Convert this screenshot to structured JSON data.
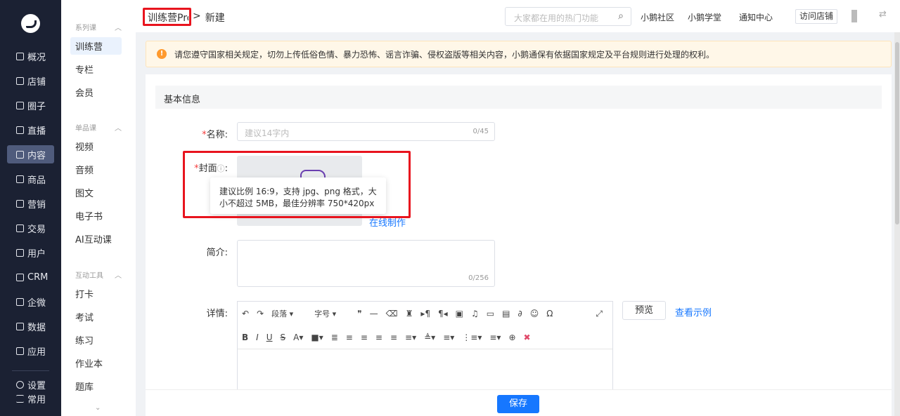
{
  "nav": {
    "items": [
      {
        "label": "概况",
        "icon": "pie-chart-icon"
      },
      {
        "label": "店铺",
        "icon": "store-icon"
      },
      {
        "label": "圈子",
        "icon": "community-icon"
      },
      {
        "label": "直播",
        "icon": "live-icon"
      },
      {
        "label": "内容",
        "icon": "document-icon",
        "active": true
      },
      {
        "label": "商品",
        "icon": "goods-icon"
      },
      {
        "label": "营销",
        "icon": "megaphone-icon"
      },
      {
        "label": "交易",
        "icon": "trade-icon"
      },
      {
        "label": "用户",
        "icon": "user-icon"
      },
      {
        "label": "CRM",
        "icon": "users-icon"
      },
      {
        "label": "企微",
        "icon": "chat-icon"
      },
      {
        "label": "数据",
        "icon": "data-icon"
      },
      {
        "label": "应用",
        "icon": "apps-icon"
      }
    ],
    "settings": "设置",
    "common": "常用"
  },
  "sub": {
    "sections": [
      {
        "title": "系列课",
        "items": [
          "训练营",
          "专栏",
          "会员"
        ]
      },
      {
        "title": "单品课",
        "items": [
          "视频",
          "音频",
          "图文",
          "电子书",
          "AI互动课"
        ]
      },
      {
        "title": "互动工具",
        "items": [
          "打卡",
          "考试",
          "练习",
          "作业本",
          "题库"
        ]
      }
    ]
  },
  "header": {
    "breadcrumb_root": "训练营Pro",
    "breadcrumb_sep": ">",
    "breadcrumb_current": "新建",
    "search_placeholder": "大家都在用的热门功能",
    "links": [
      "小鹅社区",
      "小鹅学堂",
      "通知中心"
    ],
    "visit_store": "访问店铺"
  },
  "alert": {
    "text": "请您遵守国家相关规定，切勿上传低俗色情、暴力恐怖、谣言诈骗、侵权盗版等相关内容，小鹅通保有依据国家规定及平台规则进行处理的权利。"
  },
  "form": {
    "section_title": "基本信息",
    "name": {
      "label": "名称",
      "placeholder": "建议14字内",
      "count": "0/45"
    },
    "cover": {
      "label": "封面",
      "tooltip_line1": "建议比例 16:9，支持 jpg、png 格式，大",
      "tooltip_line2": "小不超过 5MB，最佳分辨率 750*420px",
      "online_make": "在线制作"
    },
    "intro": {
      "label": "简介",
      "count": "0/256"
    },
    "detail": {
      "label": "详情",
      "paragraph": "段落",
      "fontsize": "字号",
      "preview": "预览",
      "example": "查看示例"
    }
  },
  "footer": {
    "save": "保存"
  },
  "colors": {
    "primary": "#1677ff",
    "nav_bg": "#1b2133",
    "highlight": "#e8141e",
    "warning": "#ff9a2e"
  }
}
